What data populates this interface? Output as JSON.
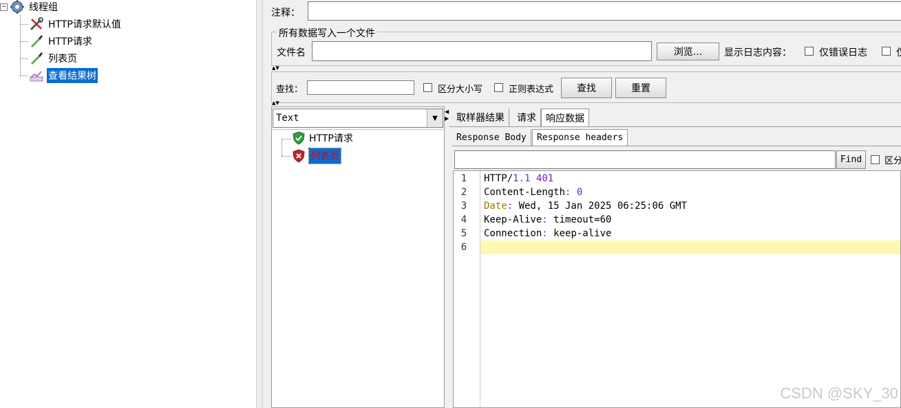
{
  "tree": {
    "root_label": "线程组",
    "items": [
      {
        "label": "HTTP请求默认值",
        "icon": "wrench-icon"
      },
      {
        "label": "HTTP请求",
        "icon": "pipette-icon"
      },
      {
        "label": "列表页",
        "icon": "pipette-icon"
      },
      {
        "label": "查看结果树",
        "icon": "graph-icon",
        "selected": true
      }
    ]
  },
  "comment": {
    "label": "注释：",
    "value": ""
  },
  "file_group": {
    "title": "所有数据写入一个文件",
    "filename_label": "文件名",
    "filename_value": "",
    "browse_label": "浏览...",
    "log_label": "显示日志内容：",
    "errors_only_label": "仅错误日志",
    "success_only_label": "仅"
  },
  "search": {
    "label": "查找：",
    "value": "",
    "case_label": "区分大小写",
    "regex_label": "正则表达式",
    "find_button": "查找",
    "reset_button": "重置"
  },
  "result_list": {
    "renderer": "Text",
    "samples": [
      {
        "label": "HTTP请求",
        "status": "success"
      },
      {
        "label": "列表页",
        "status": "error",
        "selected": true
      }
    ]
  },
  "tabs": {
    "main": [
      "取样器结果",
      "请求",
      "响应数据"
    ],
    "main_active": "响应数据",
    "sub": [
      "Response Body",
      "Response headers"
    ],
    "sub_active": "Response headers"
  },
  "find_bar": {
    "value": "",
    "button": "Find",
    "case_label": "区分"
  },
  "response_headers": {
    "line_numbers": [
      "1",
      "2",
      "3",
      "4",
      "5",
      "6"
    ],
    "lines": [
      {
        "key": "HTTP/",
        "parts": [
          "1.1",
          " ",
          "401"
        ]
      },
      {
        "key": "Content-Length",
        "sep": ": ",
        "value": "0"
      },
      {
        "key": "Date",
        "sep": ": ",
        "value": "Wed, 15 Jan 2025 06:25:06 GMT"
      },
      {
        "key": "Keep-Alive",
        "sep": ": ",
        "value": "timeout=60"
      },
      {
        "key": "Connection",
        "sep": ": ",
        "value": "keep-alive"
      }
    ]
  },
  "watermark": "CSDN @SKY_30",
  "colors": {
    "selection": "#0a6ed1",
    "current_line": "#fdf8b0",
    "error_text": "#e00000",
    "number": "#6b1cc4"
  }
}
